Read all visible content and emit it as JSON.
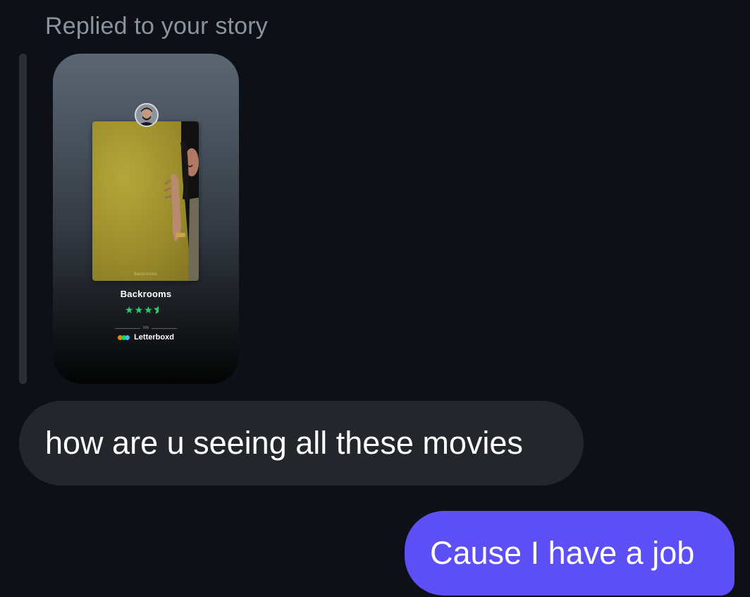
{
  "reply_context": {
    "label": "Replied to your story"
  },
  "story": {
    "poster_caption": "Backrooms",
    "movie_title": "Backrooms",
    "rating": {
      "stars_shown": "3.5 of 5",
      "full_star": "★",
      "half_star": "⯪"
    },
    "on_label": "ON",
    "brand": {
      "name": "Letterboxd",
      "dot_colors": [
        "#ff8000",
        "#00e054",
        "#40bcf4"
      ]
    },
    "star_color": "#2ecc71"
  },
  "messages": [
    {
      "direction": "received",
      "text": "how are u seeing all these movies"
    },
    {
      "direction": "sent",
      "text": "Cause I have a job"
    }
  ],
  "colors": {
    "background": "#0d1117",
    "received_bubble": "#23272c",
    "sent_bubble": "#5b4ff5"
  }
}
